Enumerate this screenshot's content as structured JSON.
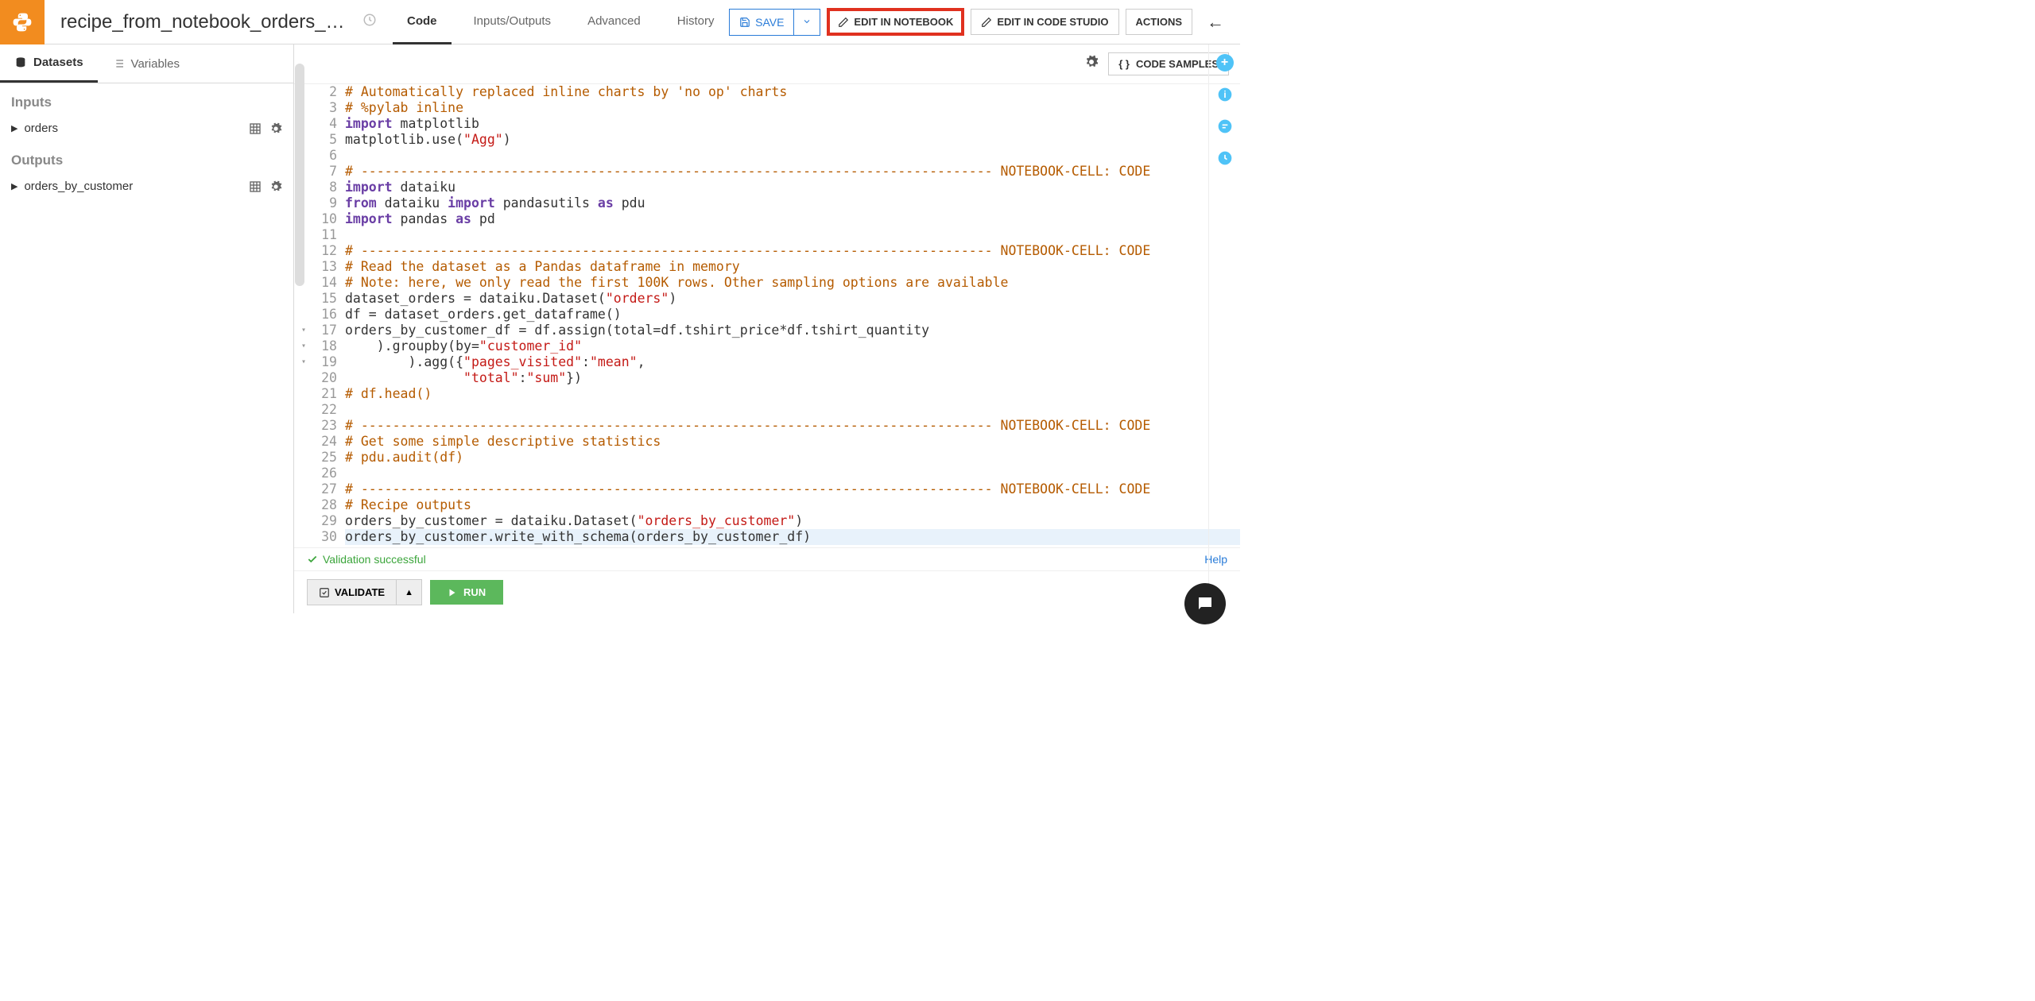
{
  "header": {
    "recipe_name": "recipe_from_notebook_orders_ana...",
    "tabs": [
      "Code",
      "Inputs/Outputs",
      "Advanced",
      "History"
    ],
    "active_tab": 0,
    "save_label": "SAVE",
    "edit_notebook": "EDIT IN NOTEBOOK",
    "edit_code_studio": "EDIT IN CODE STUDIO",
    "actions": "ACTIONS"
  },
  "sidebar": {
    "tabs": [
      {
        "label": "Datasets",
        "icon": "database-icon"
      },
      {
        "label": "Variables",
        "icon": "list-icon"
      }
    ],
    "active": 0,
    "inputs_title": "Inputs",
    "outputs_title": "Outputs",
    "inputs": [
      {
        "name": "orders"
      }
    ],
    "outputs": [
      {
        "name": "orders_by_customer"
      }
    ]
  },
  "editor_toolbar": {
    "code_samples": "CODE SAMPLES"
  },
  "code": [
    {
      "n": 2,
      "fold": "",
      "html": "<span class='c-comment'># Automatically replaced inline charts by 'no op' charts</span>"
    },
    {
      "n": 3,
      "fold": "",
      "html": "<span class='c-comment'># %pylab inline</span>"
    },
    {
      "n": 4,
      "fold": "",
      "html": "<span class='c-keyword'>import</span> matplotlib"
    },
    {
      "n": 5,
      "fold": "",
      "html": "matplotlib.use(<span class='c-string'>\"Agg\"</span>)"
    },
    {
      "n": 6,
      "fold": "",
      "html": " "
    },
    {
      "n": 7,
      "fold": "",
      "html": "<span class='c-comment'># -------------------------------------------------------------------------------- NOTEBOOK-CELL: CODE</span>"
    },
    {
      "n": 8,
      "fold": "",
      "html": "<span class='c-keyword'>import</span> dataiku"
    },
    {
      "n": 9,
      "fold": "",
      "html": "<span class='c-keyword'>from</span> dataiku <span class='c-keyword'>import</span> pandasutils <span class='c-keyword'>as</span> pdu"
    },
    {
      "n": 10,
      "fold": "",
      "html": "<span class='c-keyword'>import</span> pandas <span class='c-keyword'>as</span> pd"
    },
    {
      "n": 11,
      "fold": "",
      "html": " "
    },
    {
      "n": 12,
      "fold": "",
      "html": "<span class='c-comment'># -------------------------------------------------------------------------------- NOTEBOOK-CELL: CODE</span>"
    },
    {
      "n": 13,
      "fold": "",
      "html": "<span class='c-comment'># Read the dataset as a Pandas dataframe in memory</span>"
    },
    {
      "n": 14,
      "fold": "",
      "html": "<span class='c-comment'># Note: here, we only read the first 100K rows. Other sampling options are available</span>"
    },
    {
      "n": 15,
      "fold": "",
      "html": "dataset_orders = dataiku.Dataset(<span class='c-string'>\"orders\"</span>)"
    },
    {
      "n": 16,
      "fold": "",
      "html": "df = dataset_orders.get_dataframe()"
    },
    {
      "n": 17,
      "fold": "▾",
      "html": "orders_by_customer_df = df.assign(total=df.tshirt_price*df.tshirt_quantity"
    },
    {
      "n": 18,
      "fold": "▾",
      "html": "    ).groupby(by=<span class='c-string'>\"customer_id\"</span>"
    },
    {
      "n": 19,
      "fold": "▾",
      "html": "        ).agg({<span class='c-string'>\"pages_visited\"</span>:<span class='c-string'>\"mean\"</span>,"
    },
    {
      "n": 20,
      "fold": "",
      "html": "               <span class='c-string'>\"total\"</span>:<span class='c-string'>\"sum\"</span>})"
    },
    {
      "n": 21,
      "fold": "",
      "html": "<span class='c-comment'># df.head()</span>"
    },
    {
      "n": 22,
      "fold": "",
      "html": " "
    },
    {
      "n": 23,
      "fold": "",
      "html": "<span class='c-comment'># -------------------------------------------------------------------------------- NOTEBOOK-CELL: CODE</span>"
    },
    {
      "n": 24,
      "fold": "",
      "html": "<span class='c-comment'># Get some simple descriptive statistics</span>"
    },
    {
      "n": 25,
      "fold": "",
      "html": "<span class='c-comment'># pdu.audit(df)</span>"
    },
    {
      "n": 26,
      "fold": "",
      "html": " "
    },
    {
      "n": 27,
      "fold": "",
      "html": "<span class='c-comment'># -------------------------------------------------------------------------------- NOTEBOOK-CELL: CODE</span>"
    },
    {
      "n": 28,
      "fold": "",
      "html": "<span class='c-comment'># Recipe outputs</span>"
    },
    {
      "n": 29,
      "fold": "",
      "html": "orders_by_customer = dataiku.Dataset(<span class='c-string'>\"orders_by_customer\"</span>)"
    },
    {
      "n": 30,
      "fold": "",
      "html": "orders_by_customer.write_with_schema(orders_by_customer_df)",
      "current": true
    }
  ],
  "status": {
    "ok_text": "Validation successful",
    "help": "Help"
  },
  "bottom": {
    "validate": "VALIDATE",
    "run": "RUN"
  }
}
